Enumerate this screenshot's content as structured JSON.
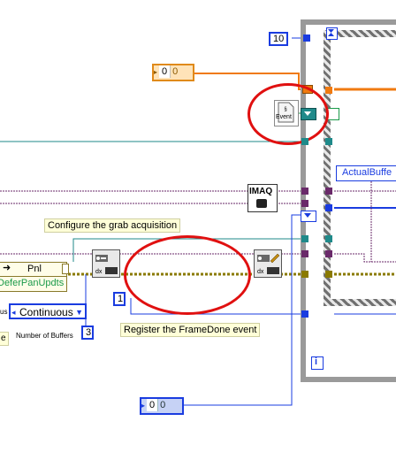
{
  "loop_count": "10",
  "timeout_control": {
    "value": "0",
    "unit_badge": "0"
  },
  "event_node_label": "Event",
  "imaq_node_label": "IMAQ",
  "actual_buffer_label": "ActualBuffe",
  "configure_label": "Configure the grab acquisition",
  "register_label": "Register the FrameDone event",
  "property_node": {
    "class": "Pnl",
    "property": "DeferPanUpdts"
  },
  "mode_ring": {
    "prefix": "us",
    "selected": "Continuous"
  },
  "number_of_buffers": {
    "label": "Number of Buffers",
    "value": "3"
  },
  "register_const": "1",
  "bottom_control": {
    "value": "0",
    "unit_badge": "0"
  },
  "loop_iteration": "i",
  "left_edge_label": "e",
  "colors": {
    "blue_wire": "#1a3ce0",
    "orange_wire": "#f07a10",
    "teal_wire": "#1f8a8a",
    "purple_wire": "#6a2a6a",
    "yellow_wire": "#8a7a00",
    "green_wire": "#1a9a4a",
    "annotation_red": "#e01010"
  }
}
